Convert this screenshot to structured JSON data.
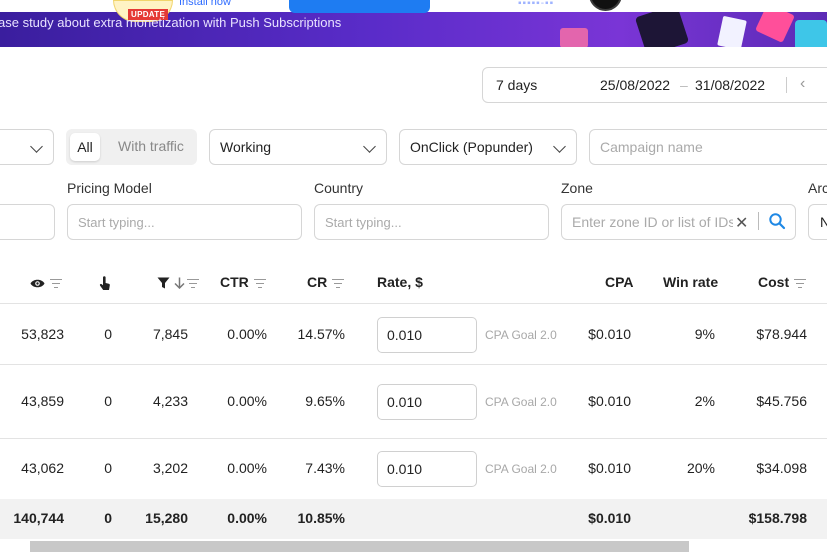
{
  "banner": {
    "badge": "UPDATE",
    "install_link": "Install now",
    "caption": "ase study about extra monetization with Push Subscriptions"
  },
  "date_range": {
    "preset": "7 days",
    "from": "25/08/2022",
    "separator": "–",
    "to": "31/08/2022"
  },
  "filters": {
    "traffic_toggle": {
      "all": "All",
      "with_traffic": "With traffic",
      "selected": "All"
    },
    "status": "Working",
    "ad_format": "OnClick (Popunder)",
    "campaign_name_placeholder": "Campaign name"
  },
  "fields": {
    "pricing_model": {
      "label": "Pricing Model",
      "placeholder": "Start typing..."
    },
    "country": {
      "label": "Country",
      "placeholder": "Start typing..."
    },
    "zone": {
      "label": "Zone",
      "placeholder": "Enter zone ID or list of IDs"
    },
    "partial_label": "Arc",
    "partial_value": "N"
  },
  "table": {
    "columns": {
      "impressions": "",
      "clicks": "",
      "conversions": "",
      "ctr": "CTR",
      "cr": "CR",
      "rate": "Rate, $",
      "cpa": "CPA",
      "win_rate": "Win rate",
      "cost": "Cost"
    },
    "rows": [
      {
        "impressions": "53,823",
        "clicks": "0",
        "conversions": "7,845",
        "ctr": "0.00%",
        "cr": "14.57%",
        "rate": "0.010",
        "goal": "CPA Goal 2.0",
        "cpa": "$0.010",
        "win_rate": "9%",
        "cost": "$78.944"
      },
      {
        "impressions": "43,859",
        "clicks": "0",
        "conversions": "4,233",
        "ctr": "0.00%",
        "cr": "9.65%",
        "rate": "0.010",
        "goal": "CPA Goal 2.0",
        "cpa": "$0.010",
        "win_rate": "2%",
        "cost": "$45.756"
      },
      {
        "impressions": "43,062",
        "clicks": "0",
        "conversions": "3,202",
        "ctr": "0.00%",
        "cr": "7.43%",
        "rate": "0.010",
        "goal": "CPA Goal 2.0",
        "cpa": "$0.010",
        "win_rate": "20%",
        "cost": "$34.098"
      }
    ],
    "total": {
      "impressions": "140,744",
      "clicks": "0",
      "conversions": "15,280",
      "ctr": "0.00%",
      "cr": "10.85%",
      "cpa": "$0.010",
      "cost": "$158.798"
    }
  },
  "icons": [
    "eye-icon",
    "pointer-click-icon",
    "funnel-icon",
    "sort-arrow-icon",
    "chevron-down-icon",
    "chevron-left-icon",
    "close-icon",
    "search-icon"
  ],
  "colors": {
    "banner": "#5a2cc9",
    "search": "#1e88e5",
    "cta": "#1e7cf2",
    "total_bg": "#f2f2f2"
  }
}
